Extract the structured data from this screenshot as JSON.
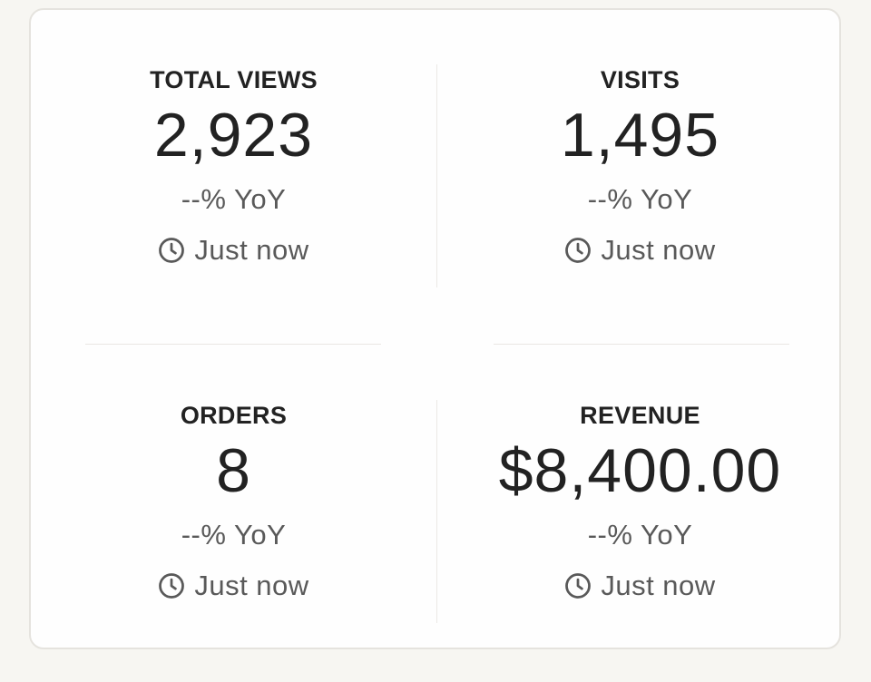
{
  "metrics": [
    {
      "label": "TOTAL VIEWS",
      "value": "2,923",
      "change": "--% YoY",
      "updated": "Just now",
      "icon": "clock-icon"
    },
    {
      "label": "VISITS",
      "value": "1,495",
      "change": "--% YoY",
      "updated": "Just now",
      "icon": "clock-icon"
    },
    {
      "label": "ORDERS",
      "value": "8",
      "change": "--% YoY",
      "updated": "Just now",
      "icon": "clock-icon"
    },
    {
      "label": "REVENUE",
      "value": "$8,400.00",
      "change": "--% YoY",
      "updated": "Just now",
      "icon": "clock-icon"
    }
  ],
  "colors": {
    "page_background": "#f7f6f2",
    "card_background": "#fefefe",
    "text_primary": "#222222",
    "text_secondary": "#595959"
  }
}
